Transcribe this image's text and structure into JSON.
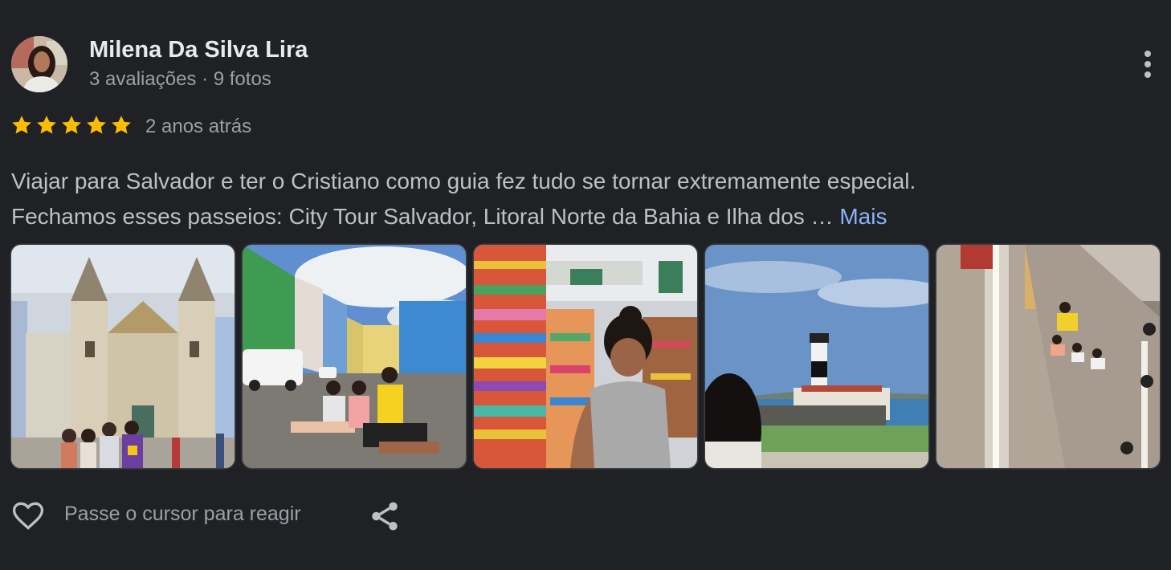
{
  "review": {
    "author_name": "Milena Da Silva Lira",
    "author_meta": "3 avaliações · 9 fotos",
    "rating": 5,
    "star_color": "#fbbc04",
    "time_ago": "2 anos atrás",
    "text_line1": "Viajar para Salvador e ter o Cristiano como guia fez tudo se tornar extremamente especial.",
    "text_line2": "Fechamos esses passeios: City Tour Salvador, Litoral Norte da Bahia e Ilha dos …",
    "more_label": "Mais",
    "link_color": "#8ab4f8",
    "photos": [
      {
        "subject": "church-facade-group"
      },
      {
        "subject": "pelourinho-street-group"
      },
      {
        "subject": "bonfim-ribbons-woman"
      },
      {
        "subject": "barra-lighthouse"
      },
      {
        "subject": "mirror-ceiling-group"
      }
    ]
  },
  "actions": {
    "react_label": "Passe o cursor para reagir",
    "icons": [
      "heart-icon",
      "share-icon",
      "more-options-icon"
    ]
  }
}
